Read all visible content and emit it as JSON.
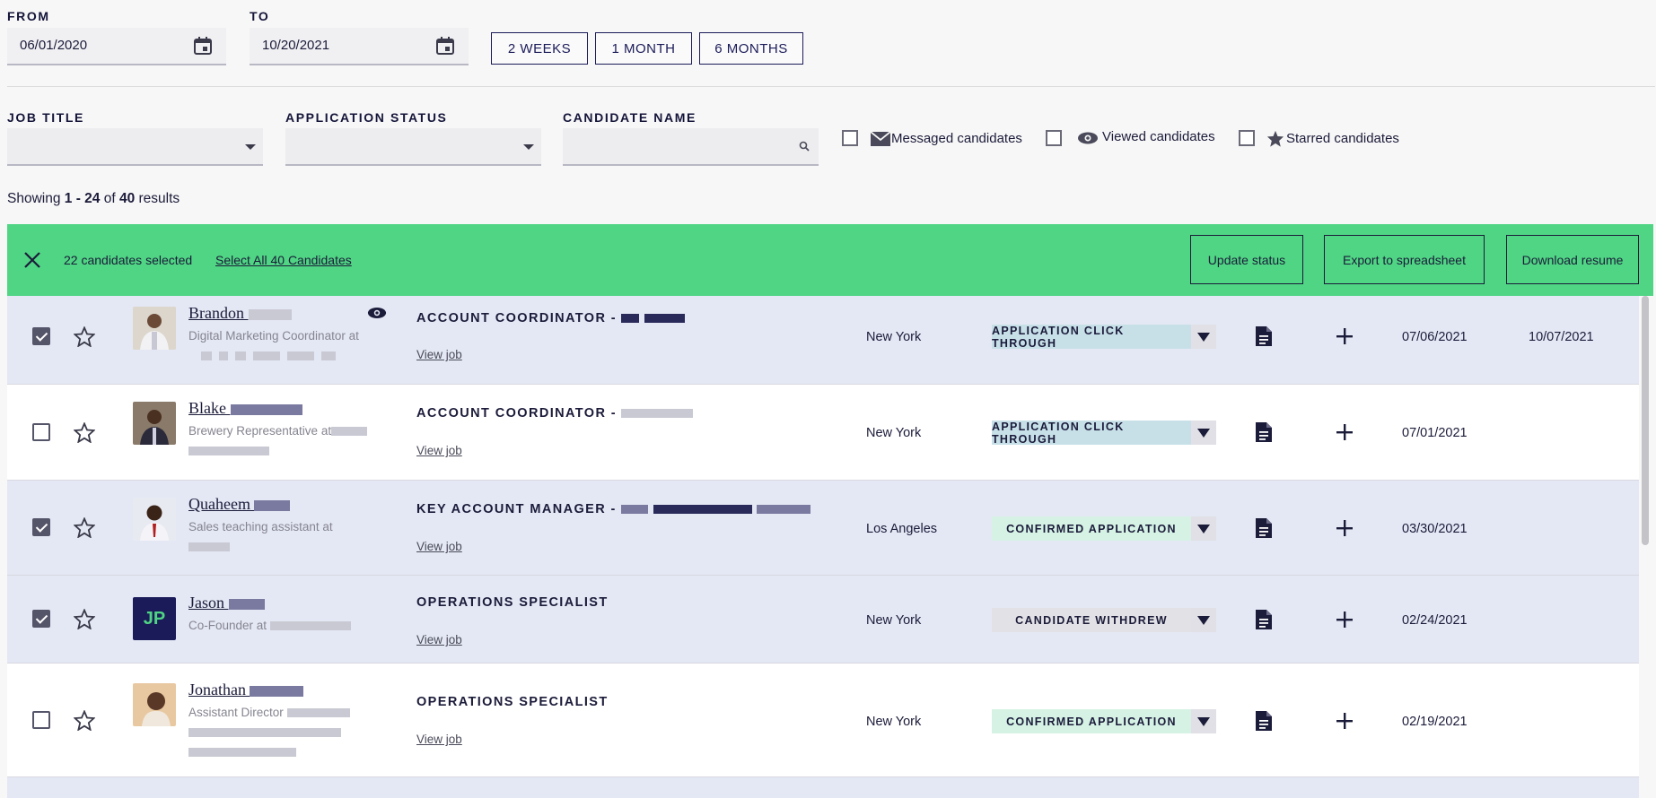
{
  "filters": {
    "from_label": "FROM",
    "from_value": "06/01/2020",
    "to_label": "TO",
    "to_value": "10/20/2021",
    "range_buttons": [
      "2 WEEKS",
      "1 MONTH",
      "6 MONTHS"
    ],
    "job_title_label": "JOB TITLE",
    "application_status_label": "APPLICATION STATUS",
    "candidate_name_label": "CANDIDATE NAME",
    "messaged_label": "Messaged candidates",
    "viewed_label": "Viewed candidates",
    "starred_label": "Starred candidates"
  },
  "results": {
    "prefix": "Showing ",
    "range": "1 - 24",
    "of": " of ",
    "total": "40",
    "suffix": " results"
  },
  "selection_banner": {
    "count_text": "22 candidates selected",
    "select_all_link": "Select All 40 Candidates",
    "update_status": "Update status",
    "export": "Export to spreadsheet",
    "download_resume": "Download resume",
    "color": "#4fd583"
  },
  "rows": [
    {
      "checked": true,
      "name": "Brandon",
      "headline": "Digital Marketing Coordinator at",
      "job_title": "ACCOUNT COORDINATOR -",
      "view_job": "View job",
      "location": "New York",
      "status": "APPLICATION CLICK THROUGH",
      "status_color": "#c7e0e8",
      "applied": "07/06/2021",
      "viewed": "10/07/2021",
      "viewed_icon": "eye-icon"
    },
    {
      "checked": false,
      "name": "Blake",
      "headline": "Brewery Representative at",
      "job_title": "ACCOUNT COORDINATOR -",
      "view_job": "View job",
      "location": "New York",
      "status": "APPLICATION CLICK THROUGH",
      "status_color": "#c7e0e8",
      "applied": "07/01/2021",
      "viewed": ""
    },
    {
      "checked": true,
      "name": "Quaheem",
      "headline": "Sales teaching assistant at",
      "job_title": "KEY ACCOUNT MANAGER -",
      "view_job": "View job",
      "location": "Los Angeles",
      "status": "CONFIRMED APPLICATION",
      "status_color": "#d5f2e4",
      "applied": "03/30/2021",
      "viewed": ""
    },
    {
      "checked": true,
      "name": "Jason",
      "headline": "Co-Founder at",
      "job_title": "OPERATIONS SPECIALIST",
      "view_job": "View job",
      "location": "New York",
      "status": "CANDIDATE WITHDREW",
      "status_color": "#e2e2e6",
      "applied": "02/24/2021",
      "viewed": "",
      "initials": "JP"
    },
    {
      "checked": false,
      "name": "Jonathan",
      "headline": "Assistant Director",
      "job_title": "OPERATIONS SPECIALIST",
      "view_job": "View job",
      "location": "New York",
      "status": "CONFIRMED APPLICATION",
      "status_color": "#d5f2e4",
      "applied": "02/19/2021",
      "viewed": ""
    }
  ]
}
